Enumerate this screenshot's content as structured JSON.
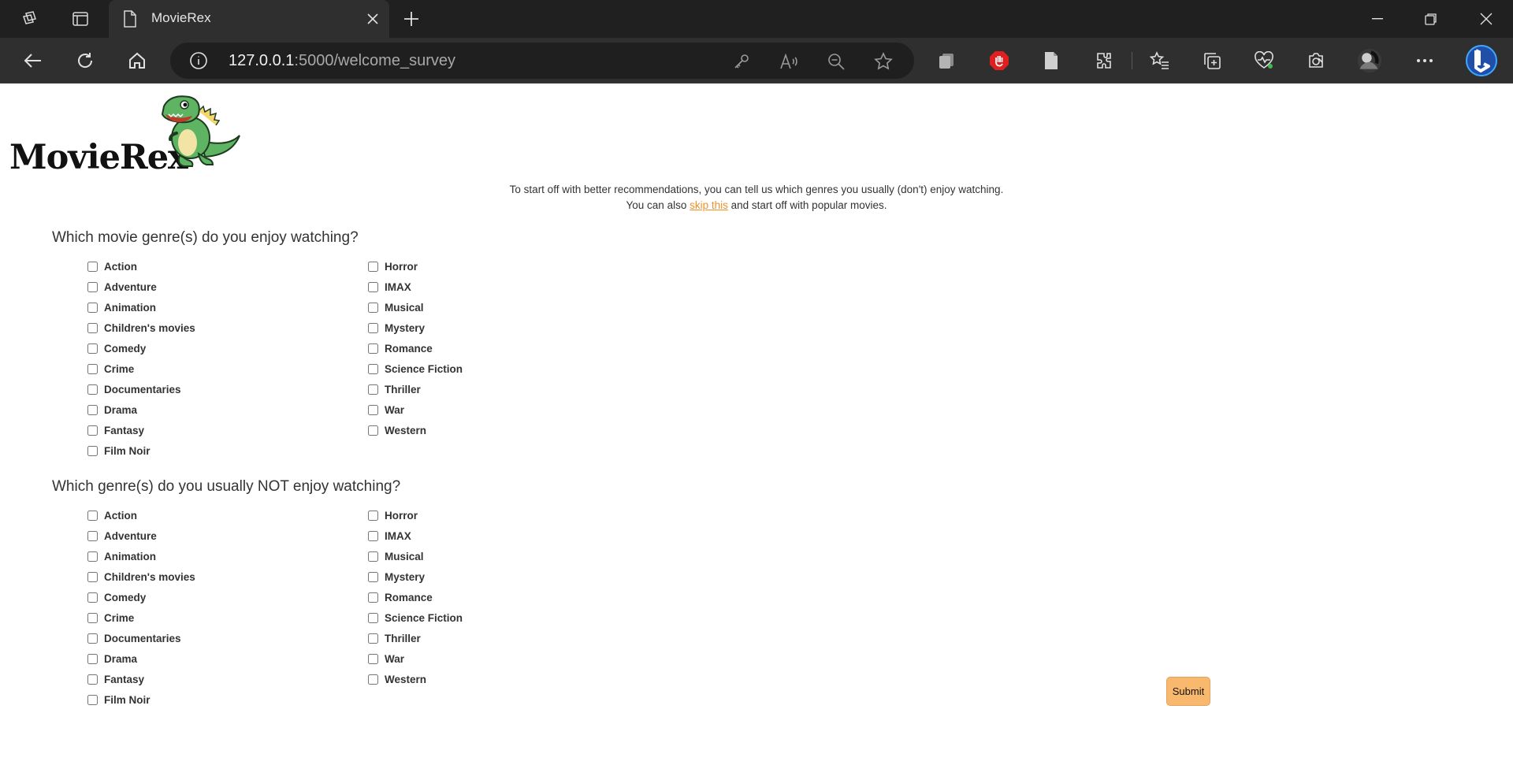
{
  "browser": {
    "tab_title": "MovieRex",
    "url_host": "127.0.0.1",
    "url_rest": ":5000/welcome_survey"
  },
  "logo": {
    "text": "MovieRex"
  },
  "intro": {
    "line1": "To start off with better recommendations, you can tell us which genres you usually (don't) enjoy watching.",
    "line2_prefix": "You can also ",
    "skip_link": "skip this",
    "line2_suffix": " and start off with popular movies."
  },
  "like_section": {
    "title": "Which movie genre(s) do you enjoy watching?",
    "col1": [
      "Action",
      "Adventure",
      "Animation",
      "Children's movies",
      "Comedy",
      "Crime",
      "Documentaries",
      "Drama",
      "Fantasy",
      "Film Noir"
    ],
    "col2": [
      "Horror",
      "IMAX",
      "Musical",
      "Mystery",
      "Romance",
      "Science Fiction",
      "Thriller",
      "War",
      "Western"
    ]
  },
  "dislike_section": {
    "title": "Which genre(s) do you usually NOT enjoy watching?",
    "col1": [
      "Action",
      "Adventure",
      "Animation",
      "Children's movies",
      "Comedy",
      "Crime",
      "Documentaries",
      "Drama",
      "Fantasy",
      "Film Noir"
    ],
    "col2": [
      "Horror",
      "IMAX",
      "Musical",
      "Mystery",
      "Romance",
      "Science Fiction",
      "Thriller",
      "War",
      "Western"
    ]
  },
  "submit_label": "Submit",
  "colors": {
    "accent": "#f8b96e",
    "link": "#f0922b"
  }
}
